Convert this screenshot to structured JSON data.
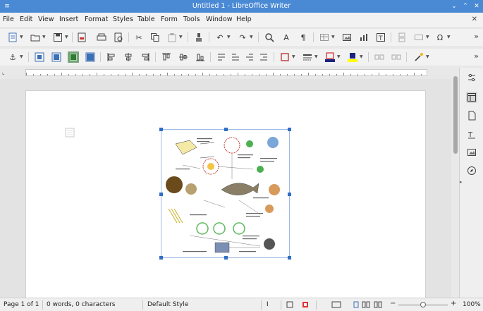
{
  "window": {
    "title": "Untitled 1 - LibreOffice Writer"
  },
  "menu": [
    "File",
    "Edit",
    "View",
    "Insert",
    "Format",
    "Styles",
    "Table",
    "Form",
    "Tools",
    "Window",
    "Help"
  ],
  "status": {
    "page": "Page 1 of 1",
    "words": "0 words, 0 characters",
    "style": "Default Style",
    "zoom": "100%"
  },
  "zoom_level": 100,
  "colors": {
    "titlebar": "#4a89d4",
    "selection": "#2f6ec5",
    "font_color": "#c00000",
    "highlight": "#ffff00",
    "border_color": "#c0504d"
  },
  "icons": {
    "toolbar1": [
      "new-document-icon",
      "open-icon",
      "save-icon",
      "export-pdf-icon",
      "print-icon",
      "print-preview-icon",
      "cut-icon",
      "copy-icon",
      "paste-icon",
      "clone-formatting-icon",
      "undo-icon",
      "redo-icon",
      "find-replace-icon",
      "spelling-icon",
      "formatting-marks-icon",
      "insert-table-icon",
      "insert-image-icon",
      "insert-chart-icon",
      "insert-textbox-icon",
      "insert-page-break-icon",
      "insert-field-icon",
      "special-character-icon"
    ],
    "toolbar2": [
      "anchor-icon",
      "wrap-off-icon",
      "wrap-page-icon",
      "wrap-optimal-icon",
      "wrap-through-icon",
      "align-left-icon",
      "align-center-icon",
      "align-right-icon",
      "align-top-icon",
      "align-middle-icon",
      "align-bottom-icon",
      "bring-forward-icon",
      "send-backward-icon",
      "bring-front-icon",
      "send-back-icon",
      "border-style-icon",
      "line-style-icon",
      "border-color-icon",
      "fill-color-icon",
      "link-frames-icon",
      "unlink-frames-icon",
      "image-effects-icon"
    ],
    "sidebar": [
      "properties-icon",
      "page-icon",
      "styles-icon",
      "gallery-icon",
      "navigator-icon"
    ]
  }
}
